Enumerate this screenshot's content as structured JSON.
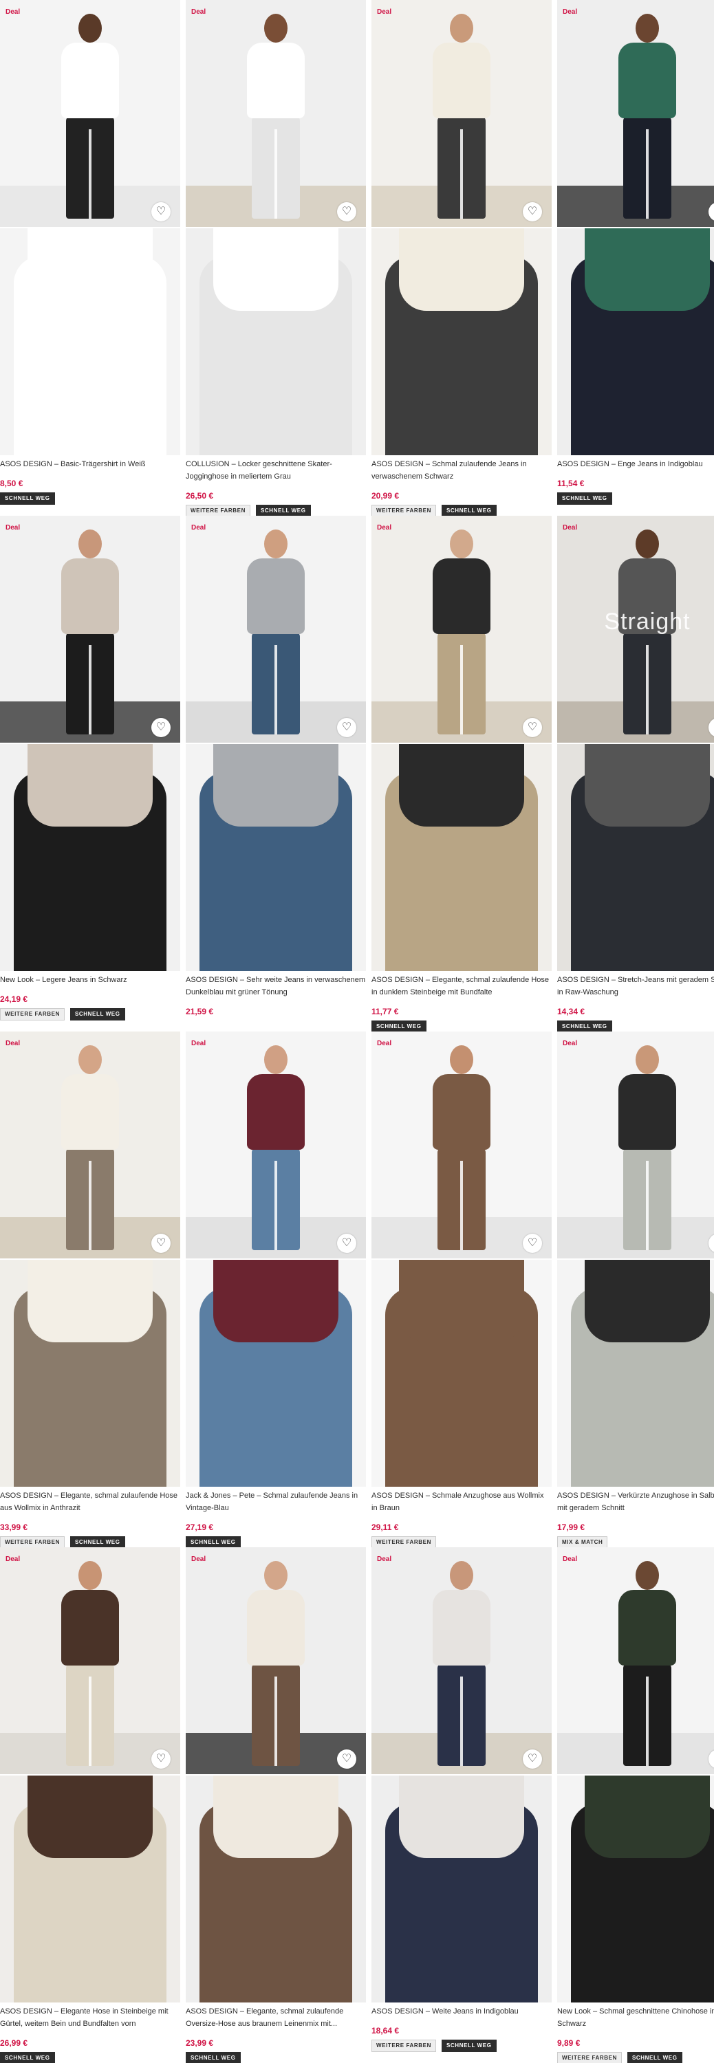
{
  "colors": {
    "deal": "#d01345",
    "price": "#d01345",
    "text": "#2d2d2d",
    "badge_dark_bg": "#2d2d2d",
    "badge_light_bg": "#eeeeee"
  },
  "icons": {
    "wishlist": "heart-icon"
  },
  "products": [
    {
      "deal": "Deal",
      "title": "ASOS DESIGN – Basic-Trägershirt in Weiß",
      "price": "8,50 €",
      "badges": [
        {
          "label": "SCHNELL WEG",
          "style": "dark"
        }
      ],
      "overlay": ""
    },
    {
      "deal": "Deal",
      "title": "COLLUSION – Locker geschnittene Skater-Jogginghose in meliertem Grau",
      "price": "26,50 €",
      "badges": [
        {
          "label": "WEITERE FARBEN",
          "style": "light"
        },
        {
          "label": "SCHNELL WEG",
          "style": "dark"
        }
      ],
      "overlay": ""
    },
    {
      "deal": "Deal",
      "title": "ASOS DESIGN – Schmal zulaufende Jeans in verwaschenem Schwarz",
      "price": "20,99 €",
      "badges": [
        {
          "label": "WEITERE FARBEN",
          "style": "light"
        },
        {
          "label": "SCHNELL WEG",
          "style": "dark"
        }
      ],
      "overlay": ""
    },
    {
      "deal": "Deal",
      "title": "ASOS DESIGN – Enge Jeans in Indigoblau",
      "price": "11,54 €",
      "badges": [
        {
          "label": "SCHNELL WEG",
          "style": "dark"
        }
      ],
      "overlay": ""
    },
    {
      "deal": "Deal",
      "title": "New Look – Legere Jeans in Schwarz",
      "price": "24,19 €",
      "badges": [
        {
          "label": "WEITERE FARBEN",
          "style": "light"
        },
        {
          "label": "SCHNELL WEG",
          "style": "dark"
        }
      ],
      "overlay": ""
    },
    {
      "deal": "Deal",
      "title": "ASOS DESIGN – Sehr weite Jeans in verwaschenem Dunkelblau mit grüner Tönung",
      "price": "21,59 €",
      "badges": [],
      "overlay": ""
    },
    {
      "deal": "Deal",
      "title": "ASOS DESIGN – Elegante, schmal zulaufende Hose in dunklem Steinbeige mit Bundfalte",
      "price": "11,77 €",
      "badges": [
        {
          "label": "SCHNELL WEG",
          "style": "dark"
        }
      ],
      "overlay": ""
    },
    {
      "deal": "Deal",
      "title": "ASOS DESIGN – Stretch-Jeans mit geradem Schnitt in Raw-Waschung",
      "price": "14,34 €",
      "badges": [
        {
          "label": "SCHNELL WEG",
          "style": "dark"
        }
      ],
      "overlay": "Straight"
    },
    {
      "deal": "Deal",
      "title": "ASOS DESIGN – Elegante, schmal zulaufende Hose aus Wollmix in Anthrazit",
      "price": "33,99 €",
      "badges": [
        {
          "label": "WEITERE FARBEN",
          "style": "light"
        },
        {
          "label": "SCHNELL WEG",
          "style": "dark"
        }
      ],
      "overlay": ""
    },
    {
      "deal": "Deal",
      "title": "Jack & Jones – Pete – Schmal zulaufende Jeans in Vintage-Blau",
      "price": "27,19 €",
      "badges": [
        {
          "label": "SCHNELL WEG",
          "style": "dark"
        }
      ],
      "overlay": ""
    },
    {
      "deal": "Deal",
      "title": "ASOS DESIGN – Schmale Anzughose aus Wollmix in Braun",
      "price": "29,11 €",
      "badges": [
        {
          "label": "WEITERE FARBEN",
          "style": "light"
        }
      ],
      "overlay": ""
    },
    {
      "deal": "Deal",
      "title": "ASOS DESIGN – Verkürzte Anzughose in Salbeigrün mit geradem Schnitt",
      "price": "17,99 €",
      "badges": [
        {
          "label": "MIX & MATCH",
          "style": "light"
        }
      ],
      "overlay": ""
    },
    {
      "deal": "Deal",
      "title": "ASOS DESIGN – Elegante Hose in Steinbeige mit Gürtel, weitem Bein und Bundfalten vorn",
      "price": "26,99 €",
      "badges": [
        {
          "label": "SCHNELL WEG",
          "style": "dark"
        }
      ],
      "overlay": ""
    },
    {
      "deal": "Deal",
      "title": "ASOS DESIGN – Elegante, schmal zulaufende Oversize-Hose aus braunem Leinenmix mit...",
      "price": "23,99 €",
      "badges": [
        {
          "label": "SCHNELL WEG",
          "style": "dark"
        }
      ],
      "overlay": ""
    },
    {
      "deal": "Deal",
      "title": "ASOS DESIGN – Weite Jeans in Indigoblau",
      "price": "18,64 €",
      "badges": [
        {
          "label": "WEITERE FARBEN",
          "style": "light"
        },
        {
          "label": "SCHNELL WEG",
          "style": "dark"
        }
      ],
      "overlay": ""
    },
    {
      "deal": "Deal",
      "title": "New Look – Schmal geschnittene Chinohose in Schwarz",
      "price": "9,89 €",
      "badges": [
        {
          "label": "WEITERE FARBEN",
          "style": "light"
        },
        {
          "label": "SCHNELL WEG",
          "style": "dark"
        }
      ],
      "overlay": ""
    }
  ]
}
